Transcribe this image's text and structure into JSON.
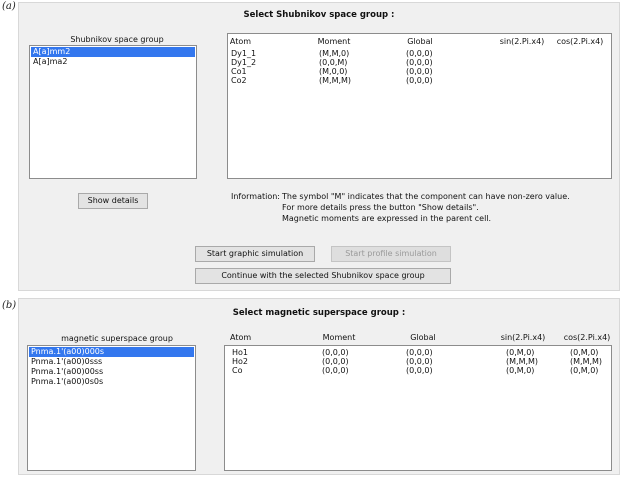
{
  "panel_a": {
    "label": "(a)",
    "title": "Select Shubnikov space group :",
    "list_caption": "Shubnikov space group",
    "groups": [
      "A[a]mm2",
      "A[a]ma2"
    ],
    "headers": [
      "Atom",
      "Moment",
      "Global",
      "sin(2.Pi.x4)",
      "cos(2.Pi.x4)"
    ],
    "rows": [
      [
        "Dy1_1",
        "(M,M,0)",
        "(0,0,0)",
        "",
        ""
      ],
      [
        "Dy1_2",
        "(0,0,M)",
        "(0,0,0)",
        "",
        ""
      ],
      [
        "Co1",
        "(M,0,0)",
        "(0,0,0)",
        "",
        ""
      ],
      [
        "Co2",
        "(M,M,M)",
        "(0,0,0)",
        "",
        ""
      ]
    ],
    "show_details": "Show details",
    "info_prefix": "Information:",
    "info_lines": [
      "The symbol \"M\" indicates that the component can have non-zero value.",
      "For more details press the button \"Show details\".",
      "Magnetic moments are expressed in the parent cell."
    ],
    "btn_graphic": "Start graphic simulation",
    "btn_profile": "Start profile simulation",
    "btn_continue": "Continue with the selected Shubnikov space group"
  },
  "panel_b": {
    "label": "(b)",
    "title": "Select magnetic superspace group :",
    "list_caption": "magnetic superspace group",
    "groups": [
      "Pnma.1'(a00)000s",
      "Pnma.1'(a00)0sss",
      "Pnma.1'(a00)00ss",
      "Pnma.1'(a00)0s0s"
    ],
    "headers": [
      "Atom",
      "Moment",
      "Global",
      "sin(2.Pi.x4)",
      "cos(2.Pi.x4)"
    ],
    "rows": [
      [
        "Ho1",
        "(0,0,0)",
        "(0,0,0)",
        "(0,M,0)",
        "(0,M,0)"
      ],
      [
        "Ho2",
        "(0,0,0)",
        "(0,0,0)",
        "(M,M,M)",
        "(M,M,M)"
      ],
      [
        "Co",
        "(0,0,0)",
        "(0,0,0)",
        "(0,M,0)",
        "(0,M,0)"
      ]
    ]
  }
}
